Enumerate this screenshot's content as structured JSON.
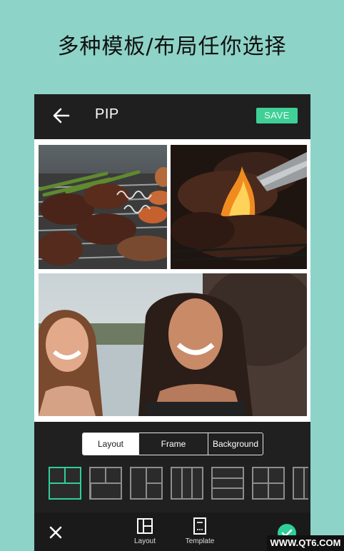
{
  "headline": "多种模板/布局任你选择",
  "appbar": {
    "title": "PIP",
    "save_label": "SAVE",
    "back_icon": "arrow-left-icon"
  },
  "tabs": [
    {
      "label": "Layout",
      "active": true
    },
    {
      "label": "Frame",
      "active": false
    },
    {
      "label": "Background",
      "active": false
    }
  ],
  "toolbar": {
    "close_icon": "close-icon",
    "layout_label": "Layout",
    "template_label": "Template",
    "confirm_icon": "check-icon"
  },
  "accent_color": "#2fcf97",
  "watermark": "WWW.QT6.COM"
}
